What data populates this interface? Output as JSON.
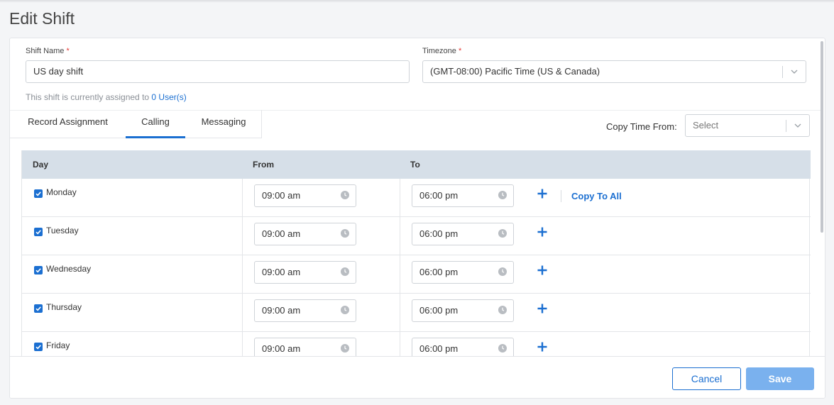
{
  "page": {
    "title": "Edit Shift"
  },
  "form": {
    "shift_name_label": "Shift Name",
    "shift_name_value": "US day shift",
    "timezone_label": "Timezone",
    "timezone_value": "(GMT-08:00) Pacific Time (US & Canada)",
    "required_mark": "*",
    "assigned_prefix": "This shift is currently assigned to",
    "assigned_link": "0 User(s)"
  },
  "tabs": [
    {
      "label": "Record Assignment",
      "active": false
    },
    {
      "label": "Calling",
      "active": true
    },
    {
      "label": "Messaging",
      "active": false
    }
  ],
  "copy_time": {
    "label": "Copy Time From:",
    "placeholder": "Select"
  },
  "table": {
    "headers": {
      "day": "Day",
      "from": "From",
      "to": "To"
    },
    "copy_to_all": "Copy To All",
    "rows": [
      {
        "day": "Monday",
        "checked": true,
        "from": "09:00 am",
        "to": "06:00 pm"
      },
      {
        "day": "Tuesday",
        "checked": true,
        "from": "09:00 am",
        "to": "06:00 pm"
      },
      {
        "day": "Wednesday",
        "checked": true,
        "from": "09:00 am",
        "to": "06:00 pm"
      },
      {
        "day": "Thursday",
        "checked": true,
        "from": "09:00 am",
        "to": "06:00 pm"
      },
      {
        "day": "Friday",
        "checked": true,
        "from": "09:00 am",
        "to": "06:00 pm"
      }
    ]
  },
  "footer": {
    "cancel_label": "Cancel",
    "save_label": "Save"
  },
  "colors": {
    "accent": "#1b6fd1",
    "header_bg": "#d6dfe8",
    "save_bg": "#7ab1ee"
  },
  "icons": {
    "checkbox": "checkbox-checked-icon",
    "clock": "clock-icon",
    "plus": "plus-icon",
    "chevron": "chevron-down-icon"
  }
}
